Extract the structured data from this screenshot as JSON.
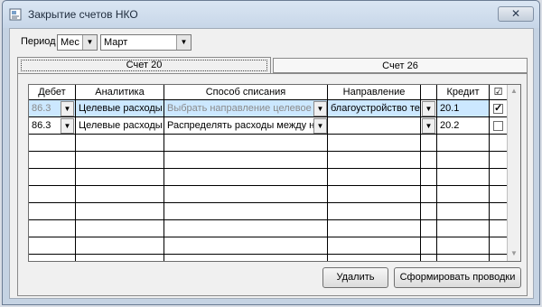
{
  "window": {
    "title": "Закрытие счетов НКО",
    "close": "✕"
  },
  "period": {
    "label": "Период",
    "type_value": "Мес",
    "month_value": "Март"
  },
  "tabs": [
    {
      "label": "Счет 20"
    },
    {
      "label": "Счет 26"
    }
  ],
  "grid": {
    "headers": {
      "debit": "Дебет",
      "analytics": "Аналитика",
      "method": "Способ списания",
      "direction": "Направление",
      "credit": "Кредит",
      "check": "☑"
    },
    "rows": [
      {
        "debit": "86.3",
        "analytics": "Целевые расходы",
        "method": "Выбрать направление целевое фи",
        "direction": "благоустройство тер",
        "credit": "20.1",
        "checked": "✓"
      },
      {
        "debit": "86.3",
        "analytics": "Целевые расходы",
        "method": "Распределять расходы между нап",
        "direction": "",
        "credit": "20.2",
        "checked": ""
      }
    ]
  },
  "buttons": {
    "delete": "Удалить",
    "generate": "Сформировать проводки"
  },
  "icons": {
    "dropdown": "▼",
    "scroll_up": "▲",
    "scroll_down": "▼"
  }
}
